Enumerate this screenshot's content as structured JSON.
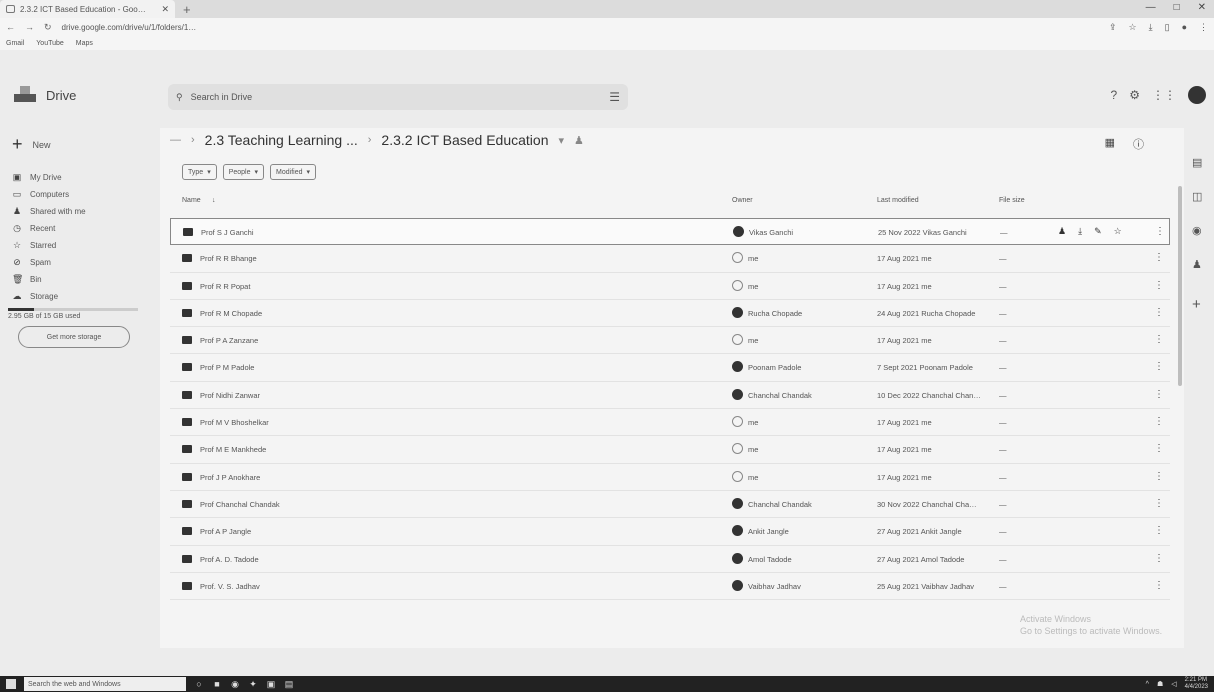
{
  "browser": {
    "tab_title": "2.3.2 ICT Based Education - Goo…",
    "url": "drive.google.com/drive/u/1/folders/1…",
    "bookmarks": [
      "Gmail",
      "YouTube",
      "Maps"
    ],
    "window_controls": [
      "—",
      "□",
      "✕"
    ]
  },
  "app": {
    "name": "Drive",
    "search_placeholder": "Search in Drive"
  },
  "nav": {
    "new_label": "New",
    "items": [
      {
        "label": "My Drive",
        "icon": "drive-icon"
      },
      {
        "label": "Computers",
        "icon": "computer-icon"
      },
      {
        "label": "Shared with me",
        "icon": "people-icon"
      },
      {
        "label": "Recent",
        "icon": "clock-icon"
      },
      {
        "label": "Starred",
        "icon": "star-icon"
      },
      {
        "label": "Spam",
        "icon": "spam-icon"
      },
      {
        "label": "Bin",
        "icon": "trash-icon"
      },
      {
        "label": "Storage",
        "icon": "cloud-icon"
      }
    ],
    "storage_text": "2.95 GB of 15 GB used",
    "storage_fraction": 0.2,
    "get_more_label": "Get more storage"
  },
  "breadcrumb": {
    "parent": "2.3 Teaching Learning ...",
    "current": "2.3.2 ICT Based Education"
  },
  "filters": [
    "Type",
    "People",
    "Modified"
  ],
  "columns": {
    "name": "Name",
    "owner": "Owner",
    "modified": "Last modified",
    "size": "File size"
  },
  "files": [
    {
      "name": "Prof S J Ganchi",
      "owner": "Vikas Ganchi",
      "modified": "25 Nov 2022 Vikas Ganchi",
      "size": "—",
      "owner_me": false
    },
    {
      "name": "Prof R R Bhange",
      "owner": "me",
      "modified": "17 Aug 2021 me",
      "size": "—",
      "owner_me": true
    },
    {
      "name": "Prof R R Popat",
      "owner": "me",
      "modified": "17 Aug 2021 me",
      "size": "—",
      "owner_me": true
    },
    {
      "name": "Prof R M Chopade",
      "owner": "Rucha Chopade",
      "modified": "24 Aug 2021 Rucha Chopade",
      "size": "—",
      "owner_me": false
    },
    {
      "name": "Prof P A Zanzane",
      "owner": "me",
      "modified": "17 Aug 2021 me",
      "size": "—",
      "owner_me": true
    },
    {
      "name": "Prof P M Padole",
      "owner": "Poonam Padole",
      "modified": "7 Sept 2021 Poonam Padole",
      "size": "—",
      "owner_me": false
    },
    {
      "name": "Prof Nidhi Zanwar",
      "owner": "Chanchal Chandak",
      "modified": "10 Dec 2022 Chanchal Chan…",
      "size": "—",
      "owner_me": false
    },
    {
      "name": "Prof M V Bhoshelkar",
      "owner": "me",
      "modified": "17 Aug 2021 me",
      "size": "—",
      "owner_me": true
    },
    {
      "name": "Prof M E Mankhede",
      "owner": "me",
      "modified": "17 Aug 2021 me",
      "size": "—",
      "owner_me": true
    },
    {
      "name": "Prof J P Anokhare",
      "owner": "me",
      "modified": "17 Aug 2021 me",
      "size": "—",
      "owner_me": true
    },
    {
      "name": "Prof Chanchal Chandak",
      "owner": "Chanchal Chandak",
      "modified": "30 Nov 2022 Chanchal Cha…",
      "size": "—",
      "owner_me": false
    },
    {
      "name": "Prof A P Jangle",
      "owner": "Ankit Jangle",
      "modified": "27 Aug 2021 Ankit Jangle",
      "size": "—",
      "owner_me": false
    },
    {
      "name": "Prof A. D. Tadode",
      "owner": "Amol Tadode",
      "modified": "27 Aug 2021 Amol Tadode",
      "size": "—",
      "owner_me": false
    },
    {
      "name": "Prof. V. S. Jadhav",
      "owner": "Vaibhav Jadhav",
      "modified": "25 Aug 2021 Vaibhav Jadhav",
      "size": "—",
      "owner_me": false
    }
  ],
  "watermark": {
    "line1": "Activate Windows",
    "line2": "Go to Settings to activate Windows."
  },
  "taskbar": {
    "search_text": "Search the web and Windows",
    "time": "2:21 PM",
    "date": "4/4/2023"
  }
}
